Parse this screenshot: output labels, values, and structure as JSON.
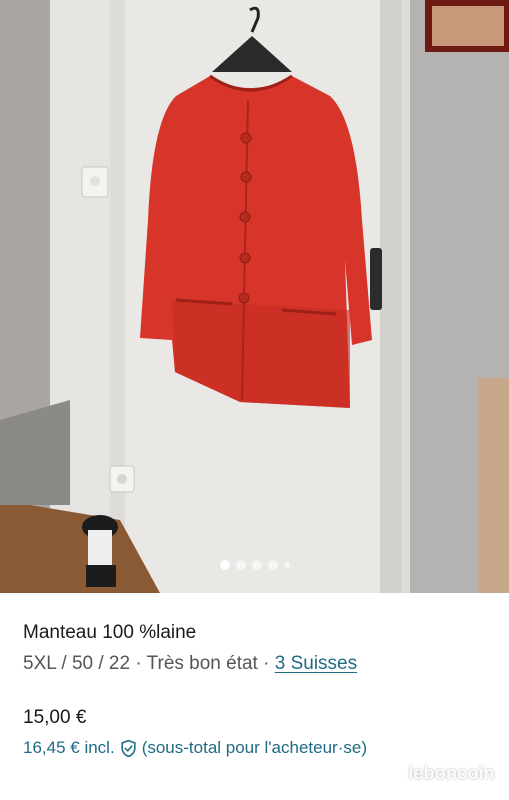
{
  "photo": {
    "alt": "Red wool coat on hanger",
    "slide_count": 5,
    "active_slide": 0
  },
  "listing": {
    "title": "Manteau 100 %laine",
    "size": "5XL / 50 / 22",
    "condition": "Très bon état",
    "brand": "3 Suisses",
    "price": "15,00 €",
    "protected_price": "16,45 € incl.",
    "protected_note": "(sous-total pour l'acheteur·se)"
  },
  "watermark": "leboncoin",
  "colors": {
    "accent": "#1f6b86",
    "coat": "#d8352a"
  }
}
